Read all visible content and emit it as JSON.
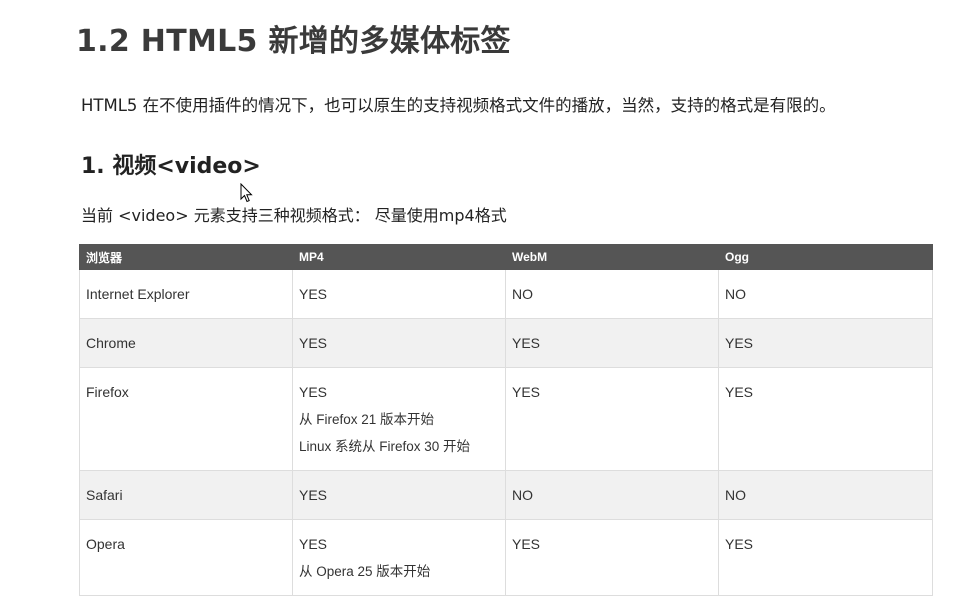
{
  "heading": "1.2 HTML5 新增的多媒体标签",
  "intro": "HTML5 在不使用插件的情况下，也可以原生的支持视频格式文件的播放，当然，支持的格式是有限的。",
  "section_title": "1. 视频<video>",
  "note": "当前 <video> 元素支持三种视频格式： 尽量使用mp4格式",
  "table": {
    "headers": [
      "浏览器",
      "MP4",
      "WebM",
      "Ogg"
    ],
    "rows": [
      {
        "browser": "Internet Explorer",
        "mp4": [
          "YES"
        ],
        "webm": "NO",
        "ogg": "NO"
      },
      {
        "browser": "Chrome",
        "mp4": [
          "YES"
        ],
        "webm": "YES",
        "ogg": "YES"
      },
      {
        "browser": "Firefox",
        "mp4": [
          "YES",
          "从 Firefox 21 版本开始",
          "Linux 系统从 Firefox 30 开始"
        ],
        "webm": "YES",
        "ogg": "YES"
      },
      {
        "browser": "Safari",
        "mp4": [
          "YES"
        ],
        "webm": "NO",
        "ogg": "NO"
      },
      {
        "browser": "Opera",
        "mp4": [
          "YES",
          "从 Opera 25 版本开始"
        ],
        "webm": "YES",
        "ogg": "YES"
      }
    ]
  },
  "icons": {
    "cursor": "mouse-pointer-icon"
  }
}
